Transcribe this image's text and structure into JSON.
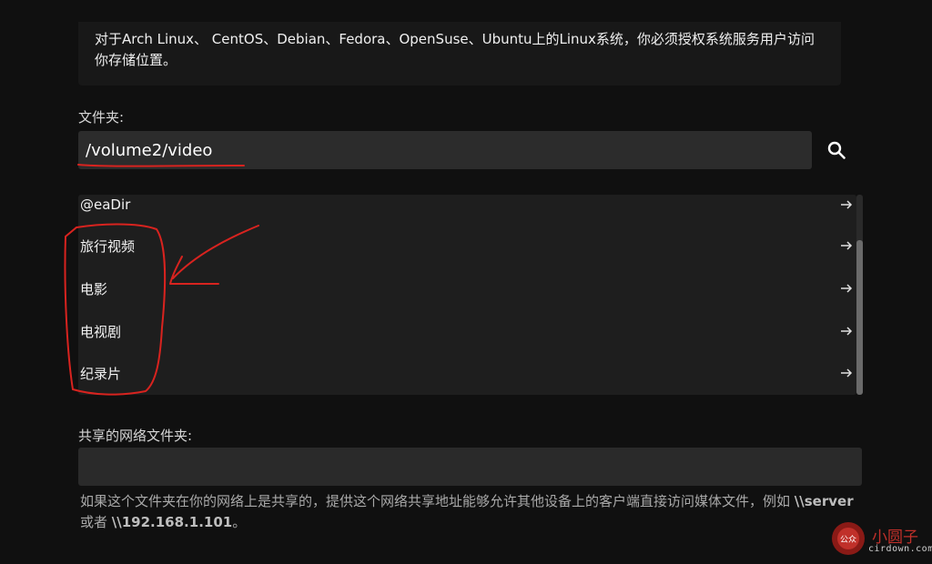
{
  "info": {
    "text": "对于Arch Linux、 CentOS、Debian、Fedora、OpenSuse、Ubuntu上的Linux系统，你必须授权系统服务用户访问你存储位置。"
  },
  "folder": {
    "label": "文件夹:",
    "path_value": "/volume2/video"
  },
  "folder_list": {
    "items": [
      {
        "name": "@eaDir"
      },
      {
        "name": "旅行视频"
      },
      {
        "name": "电影"
      },
      {
        "name": "电视剧"
      },
      {
        "name": "纪录片"
      }
    ]
  },
  "network_share": {
    "label": "共享的网络文件夹:",
    "value": "",
    "hint_prefix": "如果这个文件夹在你的网络上是共享的，提供这个网络共享地址能够允许其他设备上的客户端直接访问媒体文件，例如 ",
    "hint_example1": "\\\\server",
    "hint_middle": " 或者 ",
    "hint_example2": "\\\\192.168.1.101",
    "hint_suffix": "。"
  },
  "watermark": {
    "text": "小圆子",
    "sub": "cirdown.com",
    "logo_text": "公众"
  },
  "colors": {
    "annotation": "#d8231f",
    "background": "#101010"
  }
}
